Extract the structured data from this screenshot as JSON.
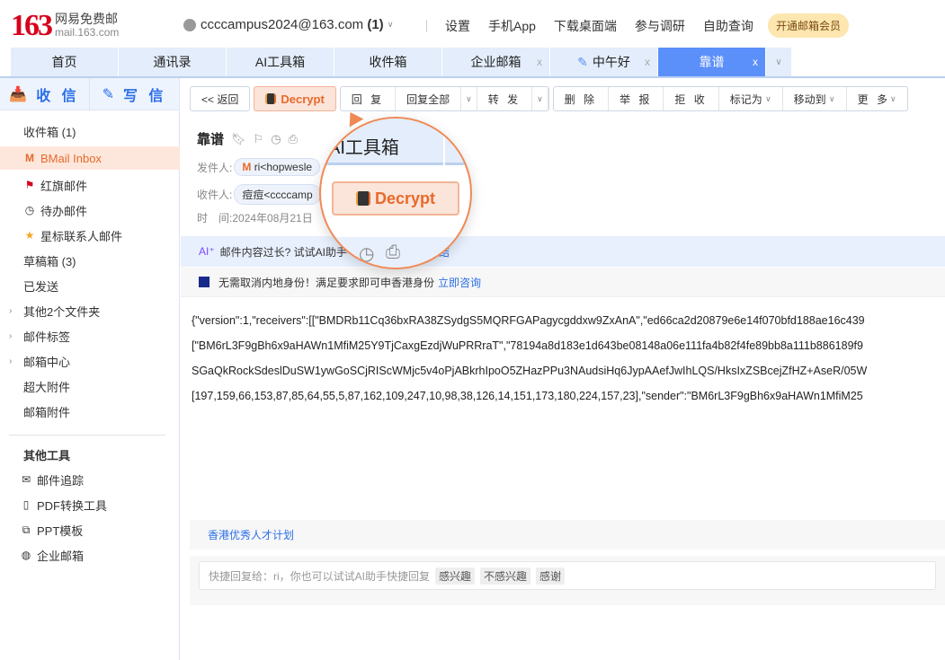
{
  "header": {
    "logo_number": "163",
    "logo_cn": "网易免费邮",
    "logo_domain": "mail.163.com",
    "account": "ccccampus2024@163.com",
    "account_count": "(1)",
    "links": [
      "设置",
      "手机App",
      "下载桌面端",
      "参与调研",
      "自助查询"
    ],
    "vip": "开通邮箱会员"
  },
  "tabs": [
    {
      "label": "首页"
    },
    {
      "label": "通讯录"
    },
    {
      "label": "AI工具箱"
    },
    {
      "label": "收件箱"
    },
    {
      "label": "企业邮箱",
      "closable": true
    },
    {
      "label": "中午好",
      "closable": true,
      "icon": "pencil-icon"
    },
    {
      "label": "靠谱",
      "closable": true,
      "active": true
    }
  ],
  "close_glyph": "x",
  "sidebar": {
    "receive": "收 信",
    "compose": "写 信",
    "items": [
      {
        "label": "收件箱 (1)"
      },
      {
        "label": "BMail Inbox"
      },
      {
        "label": "红旗邮件"
      },
      {
        "label": "待办邮件"
      },
      {
        "label": "星标联系人邮件"
      },
      {
        "label": "草稿箱 (3)"
      },
      {
        "label": "已发送"
      },
      {
        "label": "其他2个文件夹"
      },
      {
        "label": "邮件标签"
      },
      {
        "label": "邮箱中心"
      },
      {
        "label": "超大附件"
      },
      {
        "label": "邮箱附件"
      }
    ],
    "tools_title": "其他工具",
    "tools": [
      {
        "label": "邮件追踪"
      },
      {
        "label": "PDF转换工具"
      },
      {
        "label": "PPT模板"
      },
      {
        "label": "企业邮箱"
      }
    ]
  },
  "toolbar": {
    "back": "<< 返回",
    "decrypt": "Decrypt",
    "reply": "回 复",
    "reply_all": "回复全部",
    "forward": "转 发",
    "delete": "删 除",
    "report": "举 报",
    "reject": "拒 收",
    "mark": "标记为",
    "move": "移动到",
    "more": "更 多"
  },
  "mail": {
    "subject": "靠谱",
    "from_label": "发件人:",
    "from": "ri<hopwesle",
    "to_label": "收件人:",
    "to": "痘痘<ccccamp",
    "time_label": "时　间:",
    "time": "2024年08月21日",
    "ai_text": "邮件内容过长? 试试AI助手",
    "ai_link": "总结",
    "ad_text": "无需取消内地身份！满足要求即可申香港身份",
    "ad_link": "立即咨询",
    "body": [
      "{\"version\":1,\"receivers\":[[\"BMDRb11Cq36bxRA38ZSydgS5MQRFGAPagycgddxw9ZxAnA\",\"ed66ca2d20879e6e14f070bfd188ae16c439",
      "[\"BM6rL3F9gBh6x9aHAWn1MfiM25Y9TjCaxgEzdjWuPRRraT\",\"78194a8d183e1d643be08148a06e111fa4b82f4fe89bb8a111b886189f9",
      "SGaQkRockSdeslDuSW1ywGoSCjRIScWMjc5v4oPjABkrhIpoO5ZHazPPu3NAudsiHq6JypAAefJwIhLQS/HksIxZSBcejZfHZ+AseR/05W",
      "[197,159,66,153,87,85,64,55,5,87,162,109,247,10,98,38,126,14,151,173,180,224,157,23],\"sender\":\"BM6rL3F9gBh6x9aHAWn1MfiM25"
    ],
    "footer_link": "香港优秀人才计划",
    "quick_reply": "快捷回复给：ri，你也可以试试AI助手快捷回复",
    "reply_tags": [
      "感兴趣",
      "不感兴趣",
      "感谢"
    ]
  },
  "magnifier": {
    "tab": "AI工具箱",
    "button": "Decrypt"
  },
  "colors": {
    "accent": "#2a6ee8",
    "decrypt": "#e8692b",
    "active_tab": "#5b8ff9"
  }
}
